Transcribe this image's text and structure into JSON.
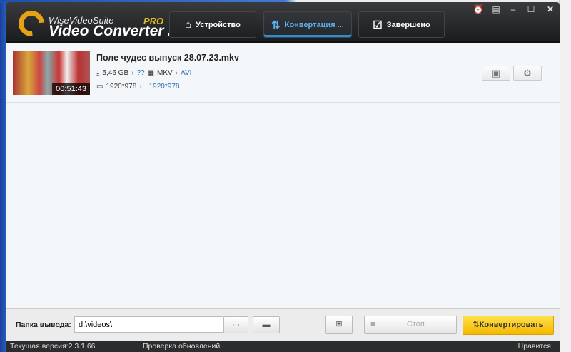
{
  "app": {
    "brand_top": "WiseVideoSuite",
    "brand_main": "Video Converter 2",
    "edition": "PRO"
  },
  "tabs": [
    {
      "label": "Устройство",
      "icon": "home-icon"
    },
    {
      "label": "Конвертация ...",
      "icon": "convert-icon",
      "active": true
    },
    {
      "label": "Завершено",
      "icon": "checkbox-icon"
    }
  ],
  "window_controls": [
    "alarm-icon",
    "skin-icon",
    "minimize-icon",
    "maximize-icon",
    "close-icon"
  ],
  "file": {
    "name": "Поле чудес выпуск 28.07.23.mkv",
    "duration": "00:51:43",
    "size": "5,46 GB",
    "size_target": "??",
    "format_src": "MKV",
    "format_dst": "AVI",
    "res_src": "1920*978",
    "res_dst": "1920*978"
  },
  "bottom": {
    "output_label": "Папка вывода:",
    "output_value": "d:\\videos\\",
    "browse_label": "···",
    "stop_label": "Стоп",
    "convert_label": "Конвертировать"
  },
  "status": {
    "version": "Текущая версия:2.3.1.66",
    "check_updates": "Проверка обновлений",
    "like": "Нравится"
  }
}
